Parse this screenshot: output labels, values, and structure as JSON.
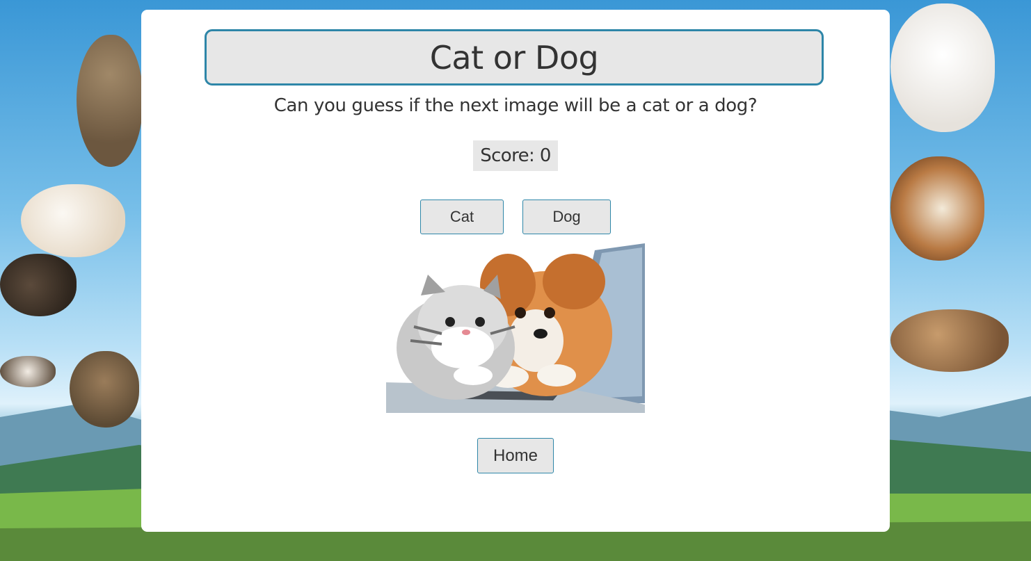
{
  "page": {
    "title": "Cat or Dog",
    "subtitle": "Can you guess if the next image will be a cat or a dog?",
    "score_label": "Score: 0"
  },
  "buttons": {
    "cat": "Cat",
    "dog": "Dog",
    "home": "Home"
  },
  "image": {
    "subject": "kitten-and-puppy-at-laptop"
  },
  "colors": {
    "accent_border": "#2e86a8",
    "panel_gray": "#e7e7e7",
    "text": "#333333",
    "card": "#ffffff"
  }
}
